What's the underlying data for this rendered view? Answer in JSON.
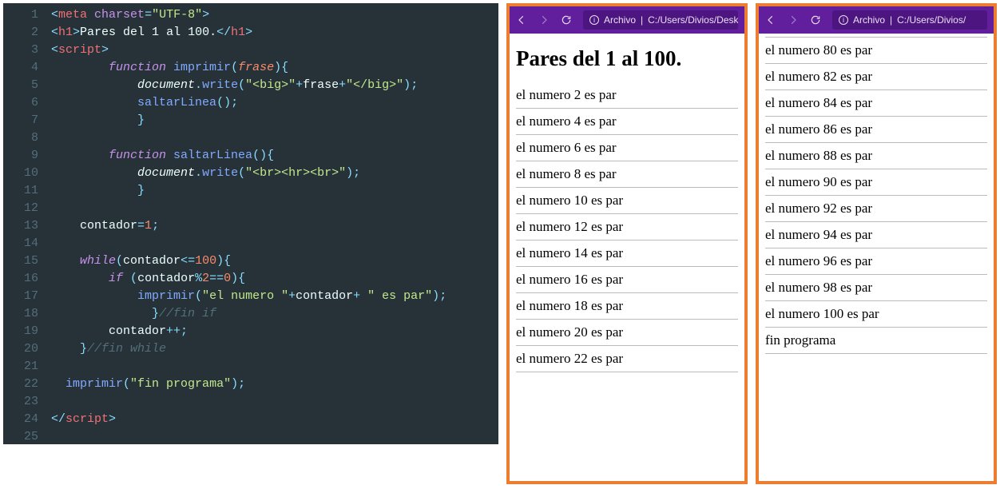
{
  "editor": {
    "line_numbers": [
      "1",
      "2",
      "3",
      "4",
      "5",
      "6",
      "7",
      "8",
      "9",
      "10",
      "11",
      "12",
      "13",
      "14",
      "15",
      "16",
      "17",
      "18",
      "19",
      "20",
      "21",
      "22",
      "23",
      "24",
      "25"
    ],
    "lines": [
      [
        [
          "c-pnc",
          "<"
        ],
        [
          "c-tag",
          "meta"
        ],
        [
          "c-txt",
          " "
        ],
        [
          "c-attr",
          "charset"
        ],
        [
          "c-op",
          "="
        ],
        [
          "c-str",
          "\"UTF-8\""
        ],
        [
          "c-pnc",
          ">"
        ]
      ],
      [
        [
          "c-pnc",
          "<"
        ],
        [
          "c-tag",
          "h1"
        ],
        [
          "c-pnc",
          ">"
        ],
        [
          "c-txt",
          "Pares del 1 al 100."
        ],
        [
          "c-pnc",
          "</"
        ],
        [
          "c-tag",
          "h1"
        ],
        [
          "c-pnc",
          ">"
        ]
      ],
      [
        [
          "c-pnc",
          "<"
        ],
        [
          "c-tag",
          "script"
        ],
        [
          "c-pnc",
          ">"
        ]
      ],
      [
        [
          "c-txt",
          "        "
        ],
        [
          "c-kw",
          "function"
        ],
        [
          "c-txt",
          " "
        ],
        [
          "c-fn",
          "imprimir"
        ],
        [
          "c-pnc",
          "("
        ],
        [
          "c-par",
          "frase"
        ],
        [
          "c-pnc",
          ")"
        ],
        [
          "c-pnc",
          "{"
        ]
      ],
      [
        [
          "c-txt",
          "            "
        ],
        [
          "c-obj",
          "document"
        ],
        [
          "c-op",
          "."
        ],
        [
          "c-fn",
          "write"
        ],
        [
          "c-pnc",
          "("
        ],
        [
          "c-str",
          "\"<big>\""
        ],
        [
          "c-op",
          "+"
        ],
        [
          "c-txt",
          "frase"
        ],
        [
          "c-op",
          "+"
        ],
        [
          "c-str",
          "\"</big>\""
        ],
        [
          "c-pnc",
          ")"
        ],
        [
          "c-pnc",
          ";"
        ]
      ],
      [
        [
          "c-txt",
          "            "
        ],
        [
          "c-fn",
          "saltarLinea"
        ],
        [
          "c-pnc",
          "()"
        ],
        [
          "c-pnc",
          ";"
        ]
      ],
      [
        [
          "c-txt",
          "            "
        ],
        [
          "c-pnc",
          "}"
        ]
      ],
      [],
      [
        [
          "c-txt",
          "        "
        ],
        [
          "c-kw",
          "function"
        ],
        [
          "c-txt",
          " "
        ],
        [
          "c-fn",
          "saltarLinea"
        ],
        [
          "c-pnc",
          "()"
        ],
        [
          "c-pnc",
          "{"
        ]
      ],
      [
        [
          "c-txt",
          "            "
        ],
        [
          "c-obj",
          "document"
        ],
        [
          "c-op",
          "."
        ],
        [
          "c-fn",
          "write"
        ],
        [
          "c-pnc",
          "("
        ],
        [
          "c-str",
          "\"<br><hr><br>\""
        ],
        [
          "c-pnc",
          ")"
        ],
        [
          "c-pnc",
          ";"
        ]
      ],
      [
        [
          "c-txt",
          "            "
        ],
        [
          "c-pnc",
          "}"
        ]
      ],
      [],
      [
        [
          "c-txt",
          "    "
        ],
        [
          "c-txt",
          "contador"
        ],
        [
          "c-op",
          "="
        ],
        [
          "c-num",
          "1"
        ],
        [
          "c-pnc",
          ";"
        ]
      ],
      [],
      [
        [
          "c-txt",
          "    "
        ],
        [
          "c-kw",
          "while"
        ],
        [
          "c-pnc",
          "("
        ],
        [
          "c-txt",
          "contador"
        ],
        [
          "c-op",
          "<="
        ],
        [
          "c-num",
          "100"
        ],
        [
          "c-pnc",
          ")"
        ],
        [
          "c-pnc",
          "{"
        ]
      ],
      [
        [
          "c-txt",
          "        "
        ],
        [
          "c-kw",
          "if"
        ],
        [
          "c-txt",
          " "
        ],
        [
          "c-pnc",
          "("
        ],
        [
          "c-txt",
          "contador"
        ],
        [
          "c-op",
          "%"
        ],
        [
          "c-num",
          "2"
        ],
        [
          "c-op",
          "=="
        ],
        [
          "c-num",
          "0"
        ],
        [
          "c-pnc",
          ")"
        ],
        [
          "c-pnc",
          "{"
        ]
      ],
      [
        [
          "c-txt",
          "            "
        ],
        [
          "c-fn",
          "imprimir"
        ],
        [
          "c-pnc",
          "("
        ],
        [
          "c-str",
          "\"el numero \""
        ],
        [
          "c-op",
          "+"
        ],
        [
          "c-txt",
          "contador"
        ],
        [
          "c-op",
          "+"
        ],
        [
          "c-txt",
          " "
        ],
        [
          "c-str",
          "\" es par\""
        ],
        [
          "c-pnc",
          ")"
        ],
        [
          "c-pnc",
          ";"
        ]
      ],
      [
        [
          "c-txt",
          "              "
        ],
        [
          "c-pnc",
          "}"
        ],
        [
          "c-cmt",
          "//fin if"
        ]
      ],
      [
        [
          "c-txt",
          "        "
        ],
        [
          "c-txt",
          "contador"
        ],
        [
          "c-op",
          "++"
        ],
        [
          "c-pnc",
          ";"
        ]
      ],
      [
        [
          "c-txt",
          "    "
        ],
        [
          "c-pnc",
          "}"
        ],
        [
          "c-cmt",
          "//fin while"
        ]
      ],
      [],
      [
        [
          "c-txt",
          "  "
        ],
        [
          "c-fn",
          "imprimir"
        ],
        [
          "c-pnc",
          "("
        ],
        [
          "c-str",
          "\"fin programa\""
        ],
        [
          "c-pnc",
          ")"
        ],
        [
          "c-pnc",
          ";"
        ]
      ],
      [],
      [
        [
          "c-pnc",
          "</"
        ],
        [
          "c-tag",
          "script"
        ],
        [
          "c-pnc",
          ">"
        ]
      ],
      []
    ]
  },
  "browser": {
    "address_label": "Archivo",
    "address_sep": " | ",
    "address_path": "C:/Users/Divios/Desktop/",
    "address_path_cut": "C:/Users/Divios/"
  },
  "pageA": {
    "title": "Pares del 1 al 100.",
    "rows": [
      "el numero 2 es par",
      "el numero 4 es par",
      "el numero 6 es par",
      "el numero 8 es par",
      "el numero 10 es par",
      "el numero 12 es par",
      "el numero 14 es par",
      "el numero 16 es par",
      "el numero 18 es par",
      "el numero 20 es par",
      "el numero 22 es par"
    ]
  },
  "pageB": {
    "rows": [
      "el numero 80 es par",
      "el numero 82 es par",
      "el numero 84 es par",
      "el numero 86 es par",
      "el numero 88 es par",
      "el numero 90 es par",
      "el numero 92 es par",
      "el numero 94 es par",
      "el numero 96 es par",
      "el numero 98 es par",
      "el numero 100 es par",
      "fin programa"
    ]
  }
}
